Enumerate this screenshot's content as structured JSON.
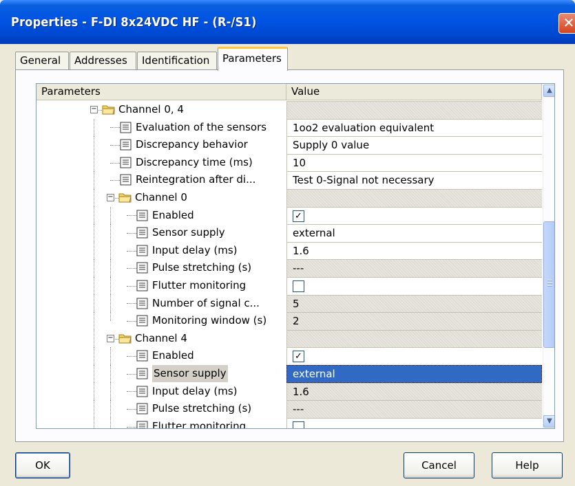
{
  "window": {
    "title": "Properties - F-DI 8x24VDC HF - (R-/S1)",
    "close_glyph": "✕"
  },
  "tabs": [
    {
      "label": "General",
      "active": false
    },
    {
      "label": "Addresses",
      "active": false
    },
    {
      "label": "Identification",
      "active": false
    },
    {
      "label": "Parameters",
      "active": true
    }
  ],
  "grid": {
    "columns": [
      "Parameters",
      "Value"
    ],
    "rows": [
      {
        "kind": "folder",
        "label": "Channel 0, 4",
        "value": "",
        "value_style": "hatch"
      },
      {
        "kind": "param",
        "label": "Evaluation of the sensors",
        "value": "1oo2 evaluation equivalent",
        "value_style": "white"
      },
      {
        "kind": "param",
        "label": "Discrepancy behavior",
        "value": "Supply 0 value",
        "value_style": "white"
      },
      {
        "kind": "param",
        "label": "Discrepancy time (ms)",
        "value": "10",
        "value_style": "white"
      },
      {
        "kind": "param",
        "label": "Reintegration after di...",
        "value": "Test 0-Signal not necessary",
        "value_style": "white"
      },
      {
        "kind": "folder",
        "label": "Channel 0",
        "value": "",
        "value_style": "hatch"
      },
      {
        "kind": "param",
        "label": "Enabled",
        "value": "✓",
        "value_style": "check-on"
      },
      {
        "kind": "param",
        "label": "Sensor supply",
        "value": "external",
        "value_style": "white"
      },
      {
        "kind": "param",
        "label": "Input delay (ms)",
        "value": "1.6",
        "value_style": "white"
      },
      {
        "kind": "param",
        "label": "Pulse stretching (s)",
        "value": "---",
        "value_style": "hatch"
      },
      {
        "kind": "param",
        "label": "Flutter monitoring",
        "value": "",
        "value_style": "check-off"
      },
      {
        "kind": "param",
        "label": "Number of signal c...",
        "value": "5",
        "value_style": "hatch"
      },
      {
        "kind": "param",
        "label": "Monitoring window (s)",
        "value": "2",
        "value_style": "hatch"
      },
      {
        "kind": "folder",
        "label": "Channel 4",
        "value": "",
        "value_style": "hatch"
      },
      {
        "kind": "param",
        "label": "Enabled",
        "value": "✓",
        "value_style": "check-on"
      },
      {
        "kind": "param",
        "label": "Sensor supply",
        "value": "external",
        "value_style": "selected",
        "label_selected": true
      },
      {
        "kind": "param",
        "label": "Input delay (ms)",
        "value": "1.6",
        "value_style": "hatch"
      },
      {
        "kind": "param",
        "label": "Pulse stretching (s)",
        "value": "---",
        "value_style": "hatch"
      },
      {
        "kind": "param",
        "label": "Flutter monitoring",
        "value": "",
        "value_style": "check-off"
      }
    ],
    "scroll_up_glyph": "▲",
    "scroll_down_glyph": "▼"
  },
  "buttons": {
    "ok": "OK",
    "cancel": "Cancel",
    "help": "Help"
  },
  "icons": {
    "folder": "folder-icon",
    "param": "parameter-icon"
  },
  "colors": {
    "titlebar": "#0054E3",
    "selection": "#316AC5",
    "dialog_bg": "#ECE9D8"
  }
}
